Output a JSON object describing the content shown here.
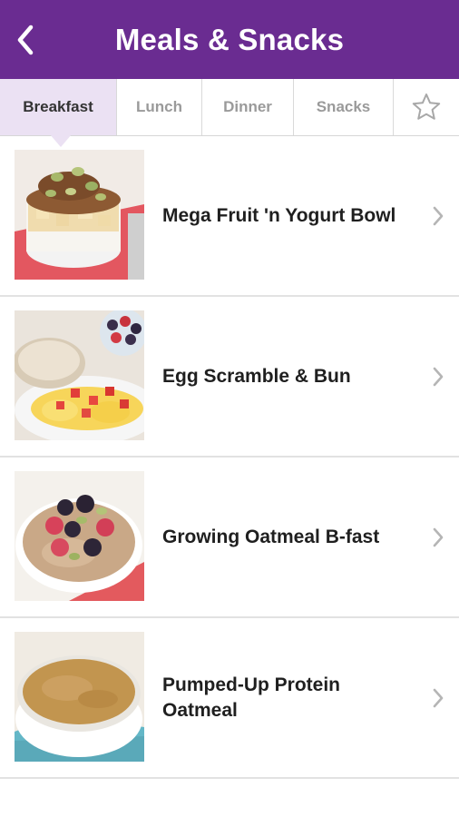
{
  "header": {
    "title": "Meals & Snacks",
    "back_icon": "chevron-left-icon",
    "background": "#6a2c91"
  },
  "tabs": [
    {
      "label": "Breakfast",
      "active": true
    },
    {
      "label": "Lunch",
      "active": false
    },
    {
      "label": "Dinner",
      "active": false
    },
    {
      "label": "Snacks",
      "active": false
    },
    {
      "icon": "star-outline-icon",
      "active": false
    }
  ],
  "meals": [
    {
      "name": "Mega Fruit 'n Yogurt Bowl"
    },
    {
      "name": "Egg Scramble & Bun"
    },
    {
      "name": "Growing Oatmeal B-fast"
    },
    {
      "name": "Pumped-Up Protein Oatmeal"
    }
  ],
  "colors": {
    "accent": "#6a2c91",
    "active_tab_bg": "#ebe1f3",
    "chevron": "#b5b5b5"
  }
}
